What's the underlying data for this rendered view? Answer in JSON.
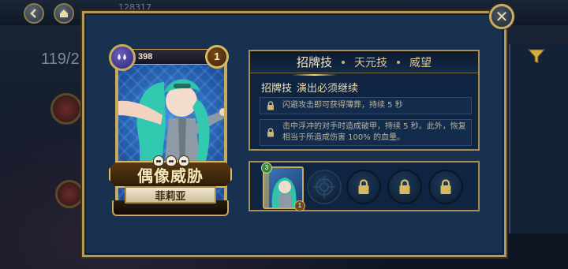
{
  "top_bar": {
    "coins": "128317",
    "back_icon": "back-arrow-icon",
    "home_icon": "home-icon"
  },
  "collection": {
    "count": "119/2"
  },
  "card": {
    "score": "398",
    "level": "1",
    "element_icon": "water-drops-icon",
    "skull_count": 3,
    "title": "偶像威胁",
    "character": "菲莉亚"
  },
  "skills": {
    "tabs": [
      {
        "label": "招牌技",
        "active": true
      },
      {
        "label": "天元技",
        "active": false
      },
      {
        "label": "威望",
        "active": false
      }
    ],
    "skill_type": "招牌技",
    "skill_name": "演出必须继续",
    "rows": [
      {
        "text": "闪避攻击即可获得薄葬，持续 5 秒",
        "locked": true
      },
      {
        "text": "击中浮冲的对手时造成破甲，持续 5 秒。此外，恢复相当于所造成伤害 100% 的血量。",
        "locked": true
      }
    ]
  },
  "slots": {
    "card_level": "3",
    "card_count": "1",
    "empty_slot_icon": "crosshair-icon",
    "locked_slots": 3,
    "lock_icon": "padlock-icon"
  },
  "colors": {
    "panel": "#18314f",
    "gold": "#b29a5e",
    "text": "#e8dcb8"
  }
}
